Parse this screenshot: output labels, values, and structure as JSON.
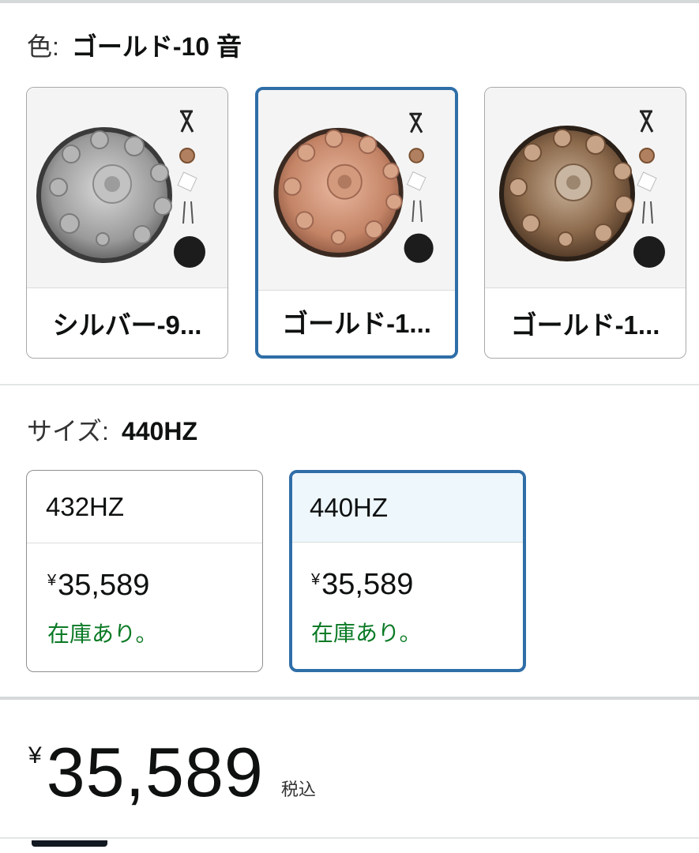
{
  "color_section": {
    "label": "色:",
    "selected_value": "ゴールド-10 音",
    "swatches": [
      {
        "caption": "シルバー-9...",
        "image": "silver-handpan-set",
        "selected": false
      },
      {
        "caption": "ゴールド-1...",
        "image": "rose-gold-handpan-set",
        "selected": true
      },
      {
        "caption": "ゴールド-1...",
        "image": "bronze-handpan-set",
        "selected": false
      }
    ]
  },
  "size_section": {
    "label": "サイズ:",
    "selected_value": "440HZ",
    "options": [
      {
        "name": "432HZ",
        "currency": "¥",
        "price": "35,589",
        "stock": "在庫あり。",
        "selected": false
      },
      {
        "name": "440HZ",
        "currency": "¥",
        "price": "35,589",
        "stock": "在庫あり。",
        "selected": true
      }
    ]
  },
  "price": {
    "currency": "¥",
    "amount": "35,589",
    "tax_note": "税込"
  },
  "colors": {
    "selected_border": "#2f6ea7",
    "selected_head_bg": "#edf7fc",
    "in_stock": "#0a7a25"
  }
}
